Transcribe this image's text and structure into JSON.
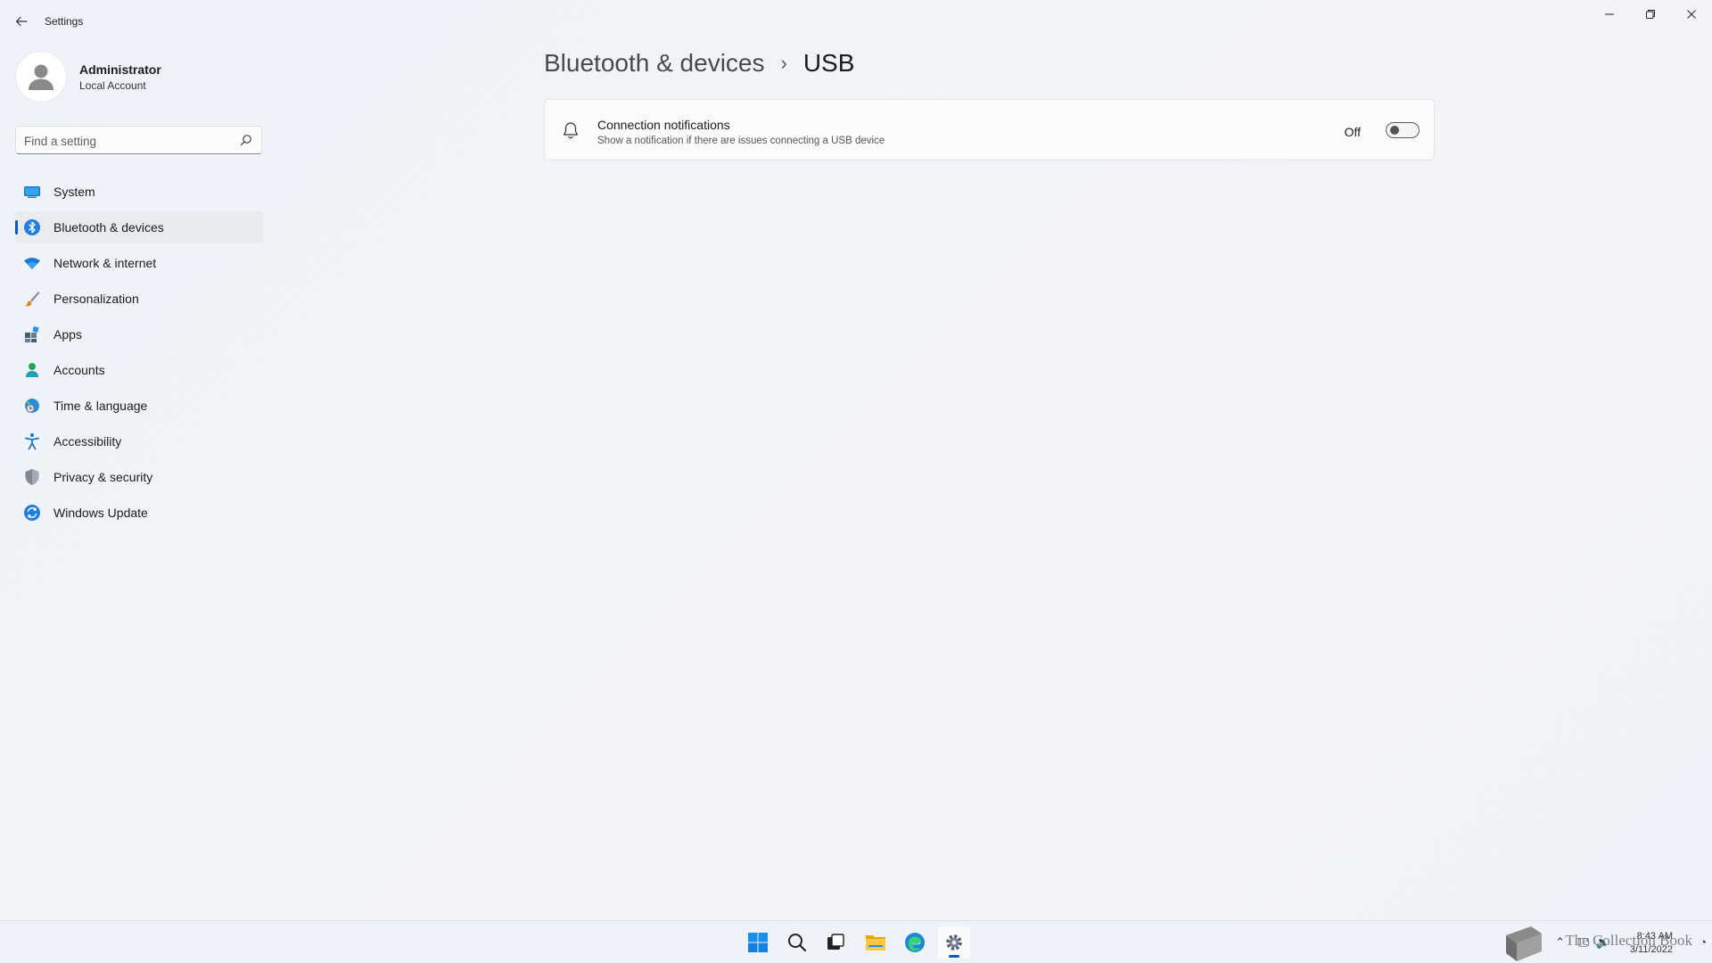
{
  "window": {
    "app_title": "Settings",
    "controls": {
      "minimize": "—",
      "restore": "❐",
      "close": "✕"
    }
  },
  "profile": {
    "name": "Administrator",
    "account_type": "Local Account"
  },
  "search": {
    "placeholder": "Find a setting",
    "value": ""
  },
  "sidebar": {
    "items": [
      {
        "label": "System",
        "icon": "monitor-icon",
        "active": false
      },
      {
        "label": "Bluetooth & devices",
        "icon": "bluetooth-icon",
        "active": true
      },
      {
        "label": "Network & internet",
        "icon": "wifi-icon",
        "active": false
      },
      {
        "label": "Personalization",
        "icon": "brush-icon",
        "active": false
      },
      {
        "label": "Apps",
        "icon": "apps-icon",
        "active": false
      },
      {
        "label": "Accounts",
        "icon": "person-icon",
        "active": false
      },
      {
        "label": "Time & language",
        "icon": "globe-clock-icon",
        "active": false
      },
      {
        "label": "Accessibility",
        "icon": "accessibility-icon",
        "active": false
      },
      {
        "label": "Privacy & security",
        "icon": "shield-icon",
        "active": false
      },
      {
        "label": "Windows Update",
        "icon": "sync-icon",
        "active": false
      }
    ]
  },
  "breadcrumb": {
    "parent": "Bluetooth & devices",
    "separator": "›",
    "current": "USB"
  },
  "settings": {
    "connection_notifications": {
      "title": "Connection notifications",
      "description": "Show a notification if there are issues connecting a USB device",
      "state_label": "Off",
      "enabled": false
    }
  },
  "taskbar": {
    "apps": [
      "start-icon",
      "search-icon",
      "task-view-icon",
      "file-explorer-icon",
      "edge-icon",
      "settings-icon"
    ],
    "active_app": "settings-icon",
    "clock": {
      "time": "8:43 AM",
      "date": "3/11/2022"
    },
    "watermark": "The Collection Book"
  },
  "colors": {
    "accent": "#005fb8",
    "background": "#f1f4f9",
    "card": "#fbfbfc"
  }
}
